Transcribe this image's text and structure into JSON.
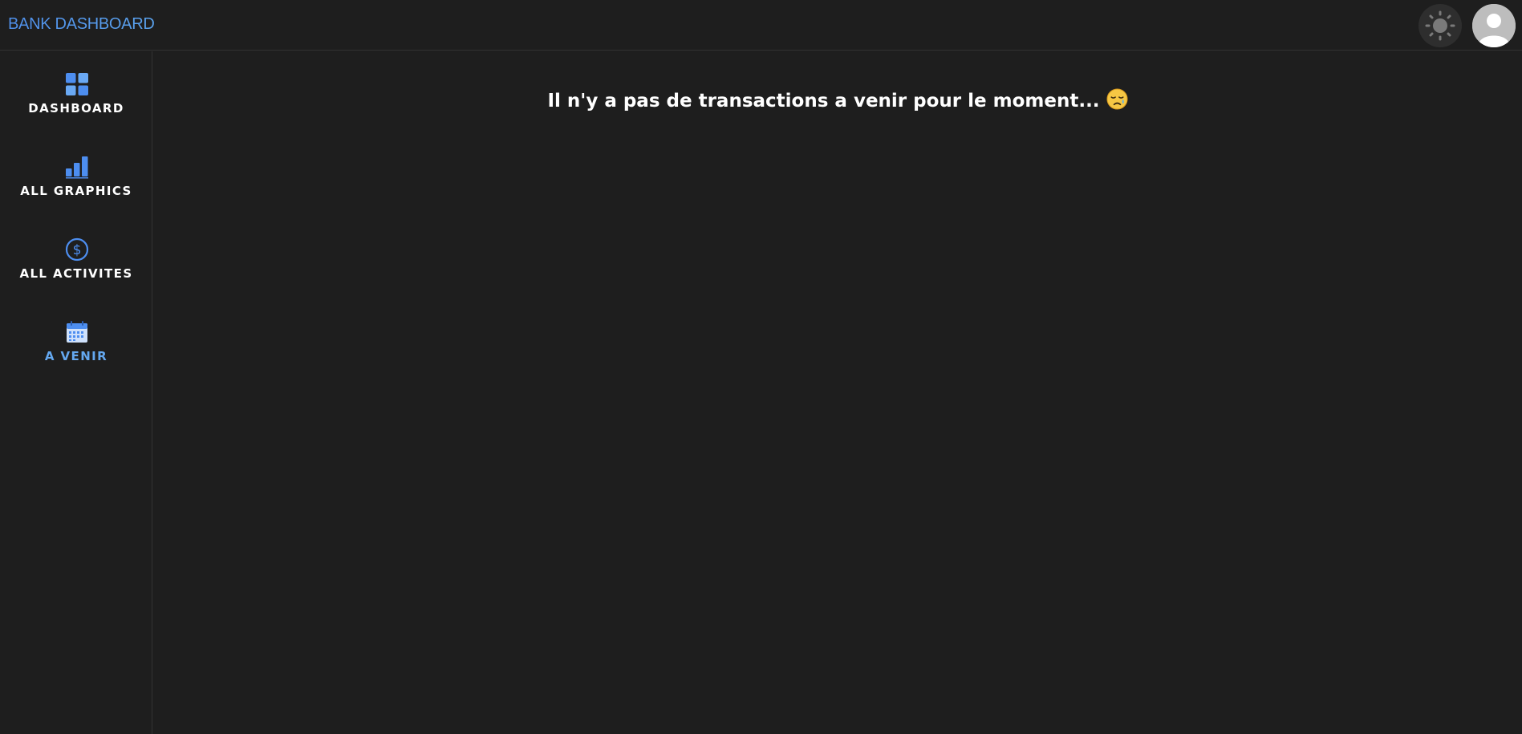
{
  "header": {
    "brand": "BANK DASHBOARD",
    "theme_toggle_icon": "sun-icon",
    "avatar_icon": "user-avatar-icon"
  },
  "sidebar": {
    "items": [
      {
        "label": "DASHBOARD",
        "icon": "dashboard-grid-icon",
        "active": false
      },
      {
        "label": "ALL GRAPHICS",
        "icon": "bar-chart-icon",
        "active": false
      },
      {
        "label": "ALL ACTIVITES",
        "icon": "dollar-circle-icon",
        "active": false
      },
      {
        "label": "A VENIR",
        "icon": "calendar-icon",
        "active": true
      }
    ]
  },
  "main": {
    "empty_message": "Il n'y a pas de transactions a venir pour le moment...",
    "emoji": "sad-relieved-face-emoji"
  },
  "colors": {
    "background": "#1e1e1e",
    "accent": "#4f8fea",
    "active_label": "#64a8f0",
    "divider": "#333333"
  }
}
